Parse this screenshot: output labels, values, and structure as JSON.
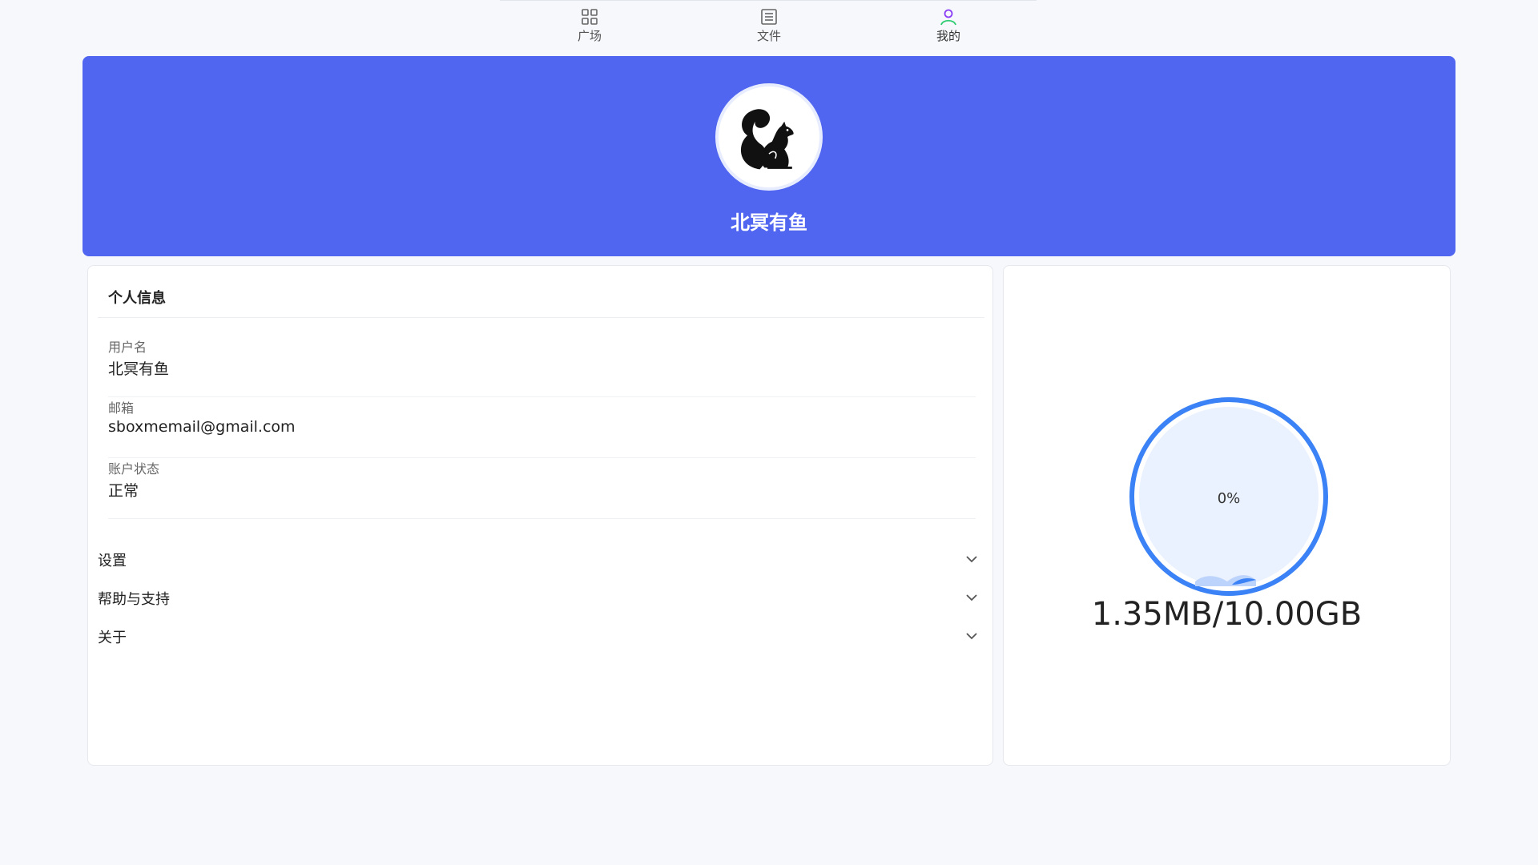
{
  "nav": {
    "items": [
      {
        "label": "广场",
        "icon": "grid-icon"
      },
      {
        "label": "文件",
        "icon": "file-list-icon"
      },
      {
        "label": "我的",
        "icon": "user-icon"
      }
    ],
    "active": "我的"
  },
  "banner": {
    "name": "北冥有鱼",
    "avatar_icon": "squirrel-avatar-icon",
    "background": "#5066f0"
  },
  "profile": {
    "title": "个人信息",
    "fields": [
      {
        "label": "用户名",
        "value": "北冥有鱼"
      },
      {
        "label": "邮箱",
        "value": "sboxmemail@gmail.com"
      },
      {
        "label": "账户状态",
        "value": "正常"
      }
    ]
  },
  "sections": [
    {
      "label": "设置"
    },
    {
      "label": "帮助与支持"
    },
    {
      "label": "关于"
    }
  ],
  "storage": {
    "percent_label": "0%",
    "usage": "1.35MB/10.00GB",
    "fill_fraction": 0.0,
    "ring_color": "#3b82f6",
    "fill_color": "#eaf1ff"
  }
}
